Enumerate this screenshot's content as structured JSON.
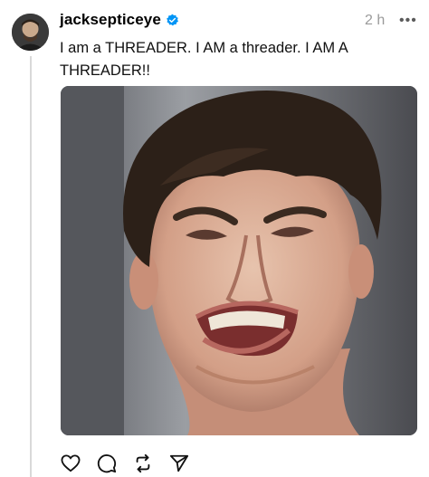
{
  "post": {
    "username": "jacksepticeye",
    "timestamp": "2 h",
    "more_label": "•••",
    "text": "I am a THREADER. I AM a threader. I AM A THREADER!!",
    "verified": true,
    "avatar_icon": "user-avatar-photo",
    "media_icon": "photo-of-grimacing-man"
  },
  "actions": [
    {
      "name": "like",
      "icon": "heart-icon"
    },
    {
      "name": "reply",
      "icon": "comment-icon"
    },
    {
      "name": "repost",
      "icon": "repost-icon"
    },
    {
      "name": "share",
      "icon": "send-icon"
    }
  ],
  "colors": {
    "verified": "#0095f6",
    "muted": "#9a9a9a",
    "line": "#d9d9d9"
  }
}
